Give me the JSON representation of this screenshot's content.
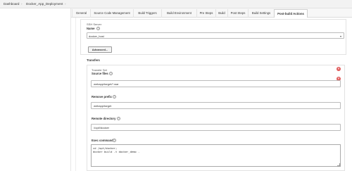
{
  "breadcrumbs": [
    "Dashboard",
    "Docker_App_Deployment"
  ],
  "tabs": [
    "General",
    "Source Code Management",
    "Build Triggers",
    "Build Environment",
    "Pre Steps",
    "Build",
    "Post Steps",
    "Build Settings",
    "Post-build Actions"
  ],
  "active_tab": "Post-build Actions",
  "ssh_server": {
    "section_label": "SSH Server",
    "name_label": "Name",
    "name_value": "docker_host",
    "advanced_button": "Advanced..."
  },
  "transfers": {
    "label": "Transfers",
    "set_label": "Transfer Set",
    "source_files_label": "Source files",
    "source_files_value": "webapp/target/*.war",
    "remove_prefix_label": "Remove prefix",
    "remove_prefix_value": "webapp/target",
    "remote_directory_label": "Remote directory",
    "remote_directory_value": "//opt//docker",
    "exec_command_label": "Exec command",
    "exec_command_lines": [
      "cd /opt/docker;",
      "docker build -t docker_demo ."
    ]
  },
  "icons": {
    "help": "question-mark-icon",
    "close": "close-icon",
    "dropdown": "chevron-down-icon",
    "breadcrumb_separator": "chevron-right-icon"
  },
  "colors": {
    "close_button": "#e05a5a",
    "tab_bar": "#f7f7f7",
    "top_bar": "#f2f2f2"
  }
}
